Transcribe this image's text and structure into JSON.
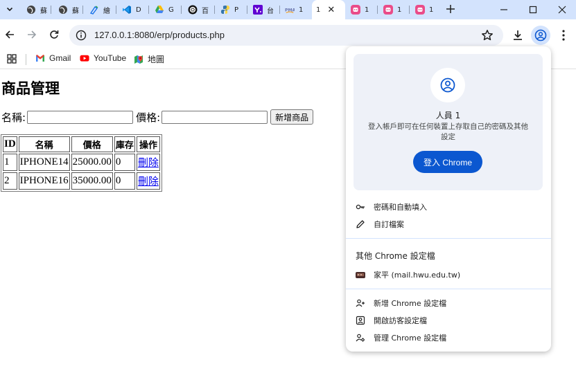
{
  "tabs": [
    {
      "icon": "globe-icon",
      "title": "蘇"
    },
    {
      "icon": "globe-icon",
      "title": "蘇"
    },
    {
      "icon": "pen-icon",
      "title": "繪"
    },
    {
      "icon": "vscode-icon",
      "title": "D"
    },
    {
      "icon": "drive-icon",
      "title": "G"
    },
    {
      "icon": "openai-icon",
      "title": "百"
    },
    {
      "icon": "python-icon",
      "title": "P"
    },
    {
      "icon": "yahoo-icon",
      "title": "台"
    },
    {
      "icon": "pma-icon",
      "title": "1"
    },
    {
      "icon": "none",
      "title": "1",
      "active": true
    },
    {
      "icon": "app-icon",
      "title": "1"
    },
    {
      "icon": "app-icon",
      "title": "1"
    },
    {
      "icon": "app-icon",
      "title": "1"
    }
  ],
  "toolbar": {
    "url": "127.0.0.1:8080/erp/products.php"
  },
  "bookmarks": [
    {
      "icon": "gmail-icon",
      "label": "Gmail"
    },
    {
      "icon": "youtube-icon",
      "label": "YouTube"
    },
    {
      "icon": "maps-icon",
      "label": "地圖"
    }
  ],
  "page": {
    "title": "商品管理",
    "form": {
      "name_label": "名稱:",
      "price_label": "價格:",
      "submit_label": "新增商品"
    },
    "table": {
      "headers": [
        "ID",
        "名稱",
        "價格",
        "庫存",
        "操作"
      ],
      "rows": [
        {
          "id": "1",
          "name": "IPHONE14",
          "price": "25000.00",
          "stock": "0",
          "action": "刪除"
        },
        {
          "id": "2",
          "name": "IPHONE16",
          "price": "35000.00",
          "stock": "0",
          "action": "刪除"
        }
      ]
    }
  },
  "profile_menu": {
    "person_name": "人員 1",
    "description": "登入帳戶即可在任何裝置上存取自己的密碼及其他設定",
    "signin_label": "登入 Chrome",
    "items_top": [
      {
        "icon": "key-icon",
        "label": "密碼和自動填入"
      },
      {
        "icon": "pencil-icon",
        "label": "自訂檔案"
      }
    ],
    "other_profiles_heading": "其他 Chrome 設定檔",
    "other_profiles": [
      {
        "icon": "profile-photo-icon",
        "label": "家平 (mail.hwu.edu.tw)"
      }
    ],
    "items_bottom": [
      {
        "icon": "add-person-icon",
        "label": "新增 Chrome 設定檔"
      },
      {
        "icon": "guest-icon",
        "label": "開啟訪客設定檔"
      },
      {
        "icon": "manage-profiles-icon",
        "label": "管理 Chrome 設定檔"
      }
    ]
  },
  "colors": {
    "tabstrip": "#d3e3fd",
    "accent": "#0b57d0",
    "link": "#0000ee"
  }
}
